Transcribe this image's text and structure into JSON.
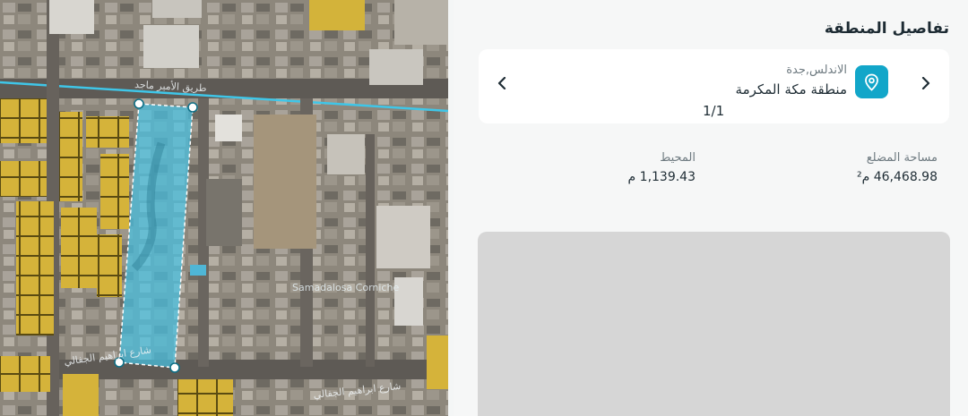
{
  "panel": {
    "title": "تفاصيل المنطقة",
    "location": {
      "district_city": "الاندلس,جدة",
      "region": "منطقة مكة المكرمة",
      "pager": "1/1"
    },
    "stats": {
      "area_label": "مساحة المضلع",
      "area_value": "46,468.98 م²",
      "perimeter_label": "المحيط",
      "perimeter_value": "1,139.43 م"
    }
  },
  "map": {
    "street_labels": [
      "طريق الأمير ماجد",
      "شارع ابراهيم الجفالي",
      "شارع ابراهيم الجفالي"
    ],
    "area_label": "Samadalosa Corniche",
    "colors": {
      "parcel_fill": "#d9b83a",
      "parcel_stroke": "#5a4b12",
      "selection_fill": "#46c3e6",
      "selection_stroke": "#ffffff",
      "road_line": "#3fc6e8"
    }
  },
  "icons": {
    "next": "chevron-right-icon",
    "prev": "chevron-left-icon",
    "pin": "location-pin-icon"
  },
  "colors": {
    "accent": "#12a6c9",
    "panel_bg": "#f6f7f7",
    "card_bg": "#ffffff",
    "placeholder": "#d6d6d6",
    "text_primary": "#1f2d35",
    "text_secondary": "#6e7a80"
  }
}
